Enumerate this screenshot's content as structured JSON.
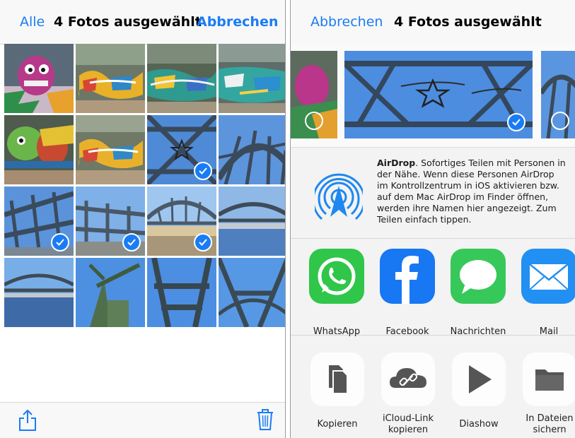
{
  "left_screen": {
    "navbar": {
      "all_label": "Alle",
      "title": "4 Fotos ausgewählt",
      "cancel_label": "Abbrechen"
    },
    "photos": [
      {
        "subject": "graffiti",
        "selected": false
      },
      {
        "subject": "graffiti",
        "selected": false
      },
      {
        "subject": "graffiti",
        "selected": false
      },
      {
        "subject": "graffiti",
        "selected": false
      },
      {
        "subject": "graffiti",
        "selected": false
      },
      {
        "subject": "graffiti",
        "selected": false
      },
      {
        "subject": "bridge-star",
        "selected": true
      },
      {
        "subject": "bridge",
        "selected": false
      },
      {
        "subject": "bridge",
        "selected": true
      },
      {
        "subject": "bridge",
        "selected": true
      },
      {
        "subject": "bridge",
        "selected": true
      },
      {
        "subject": "bridge-river",
        "selected": false
      },
      {
        "subject": "bridge-river",
        "selected": false
      },
      {
        "subject": "crane",
        "selected": false
      },
      {
        "subject": "bridge-beams",
        "selected": false
      },
      {
        "subject": "bridge-beams",
        "selected": false
      }
    ],
    "toolbar": {
      "share_icon": "share-icon",
      "trash_icon": "trash-icon"
    }
  },
  "right_screen": {
    "navbar": {
      "cancel_label": "Abbrechen",
      "title": "4 Fotos ausgewählt"
    },
    "airdrop": {
      "title": "AirDrop",
      "description": ". Sofortiges Teilen mit Personen in der Nähe. Wenn diese Personen AirDrop im Kontrollzentrum in iOS aktivieren bzw. auf dem Mac AirDrop im Finder öffnen, werden ihre Namen hier angezeigt. Zum Teilen einfach tippen."
    },
    "apps": [
      {
        "label": "WhatsApp",
        "icon": "whatsapp-icon",
        "color": "#25c23f"
      },
      {
        "label": "Facebook",
        "icon": "facebook-icon",
        "color": "#1877f2"
      },
      {
        "label": "Nachrichten",
        "icon": "messages-icon",
        "color": "#34c759"
      },
      {
        "label": "Mail",
        "icon": "mail-icon",
        "color": "#1f8ff0"
      }
    ],
    "actions": [
      {
        "label": "Kopieren",
        "icon": "copy-icon"
      },
      {
        "label": "iCloud-Link kopieren",
        "icon": "icloud-link-icon"
      },
      {
        "label": "Diashow",
        "icon": "play-icon"
      },
      {
        "label": "In Dateien sichern",
        "icon": "folder-icon"
      }
    ]
  },
  "colors": {
    "accent": "#1a7cf5",
    "sky": "#3f86d9",
    "steel": "#3d4f63"
  }
}
